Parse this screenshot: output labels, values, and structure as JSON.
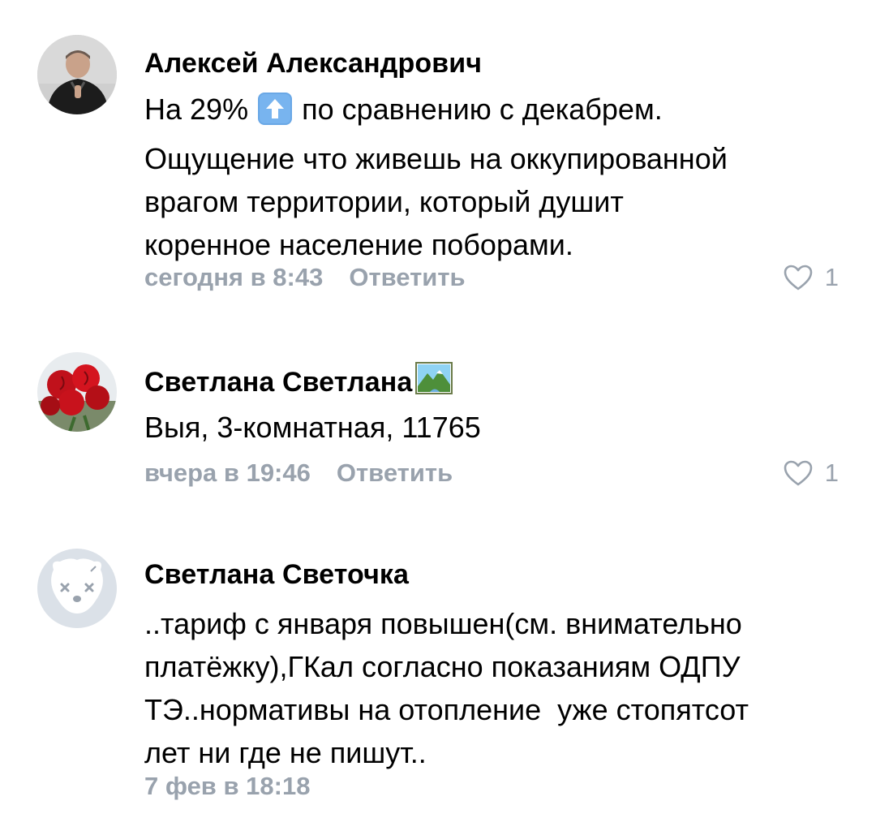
{
  "comments": [
    {
      "author": "Алексей Александрович",
      "text_before": "На 29%",
      "text_after": "по сравнению с декабрем.",
      "lines": [
        "Ощущение что живешь на оккупированной",
        "врагом территории, который душит",
        "коренное население поборами."
      ],
      "inline_emoji": "up-arrow-icon",
      "time": "сегодня в 8:43",
      "reply_label": "Ответить",
      "likes": "1"
    },
    {
      "author": "Светлана Светлана",
      "author_emoji": "landscape-icon",
      "text": "Выя, 3-комнатная, 11765",
      "time": "вчера в 19:46",
      "reply_label": "Ответить",
      "likes": "1"
    },
    {
      "author": "Светлана Светочка",
      "lines": [
        "..тариф с января повышен(см. внимательно",
        "платёжку),ГКал согласно показаниям ОДПУ",
        "ТЭ..нормативы на отопление  уже стопятсот",
        "лет ни где не пишут.."
      ],
      "time": "7 фев в 18:18"
    }
  ],
  "colors": {
    "meta": "#99a2ad",
    "text": "#000000",
    "background": "#ffffff"
  }
}
